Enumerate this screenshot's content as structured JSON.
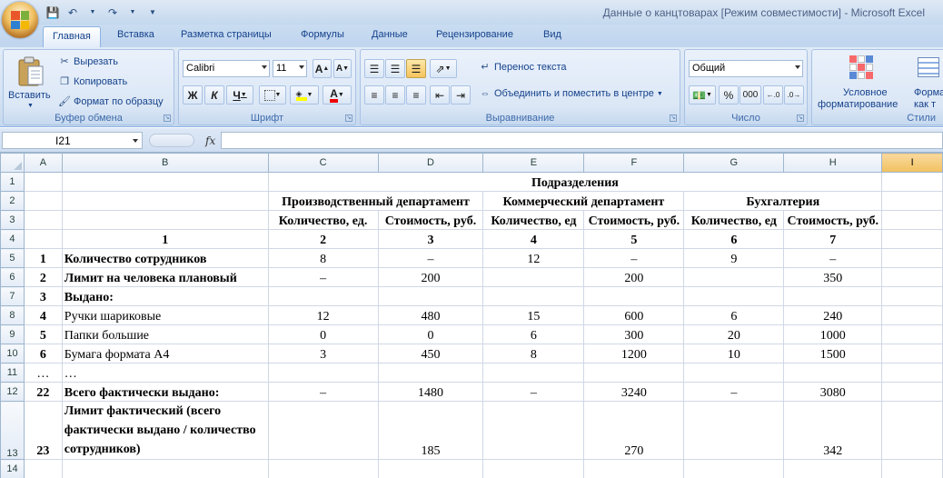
{
  "window": {
    "title": "Данные о канцтоварах  [Режим совместимости] - Microsoft Excel"
  },
  "tabs": [
    "Главная",
    "Вставка",
    "Разметка страницы",
    "Формулы",
    "Данные",
    "Рецензирование",
    "Вид"
  ],
  "ribbon": {
    "clipboard": {
      "label": "Буфер обмена",
      "paste": "Вставить",
      "cut": "Вырезать",
      "copy": "Копировать",
      "format_painter": "Формат по образцу"
    },
    "font": {
      "label": "Шрифт",
      "name": "Calibri",
      "size": "11",
      "bold": "Ж",
      "italic": "К",
      "underline": "Ч",
      "grow": "A",
      "shrink": "A",
      "color_letter": "A"
    },
    "alignment": {
      "label": "Выравнивание",
      "wrap": "Перенос текста",
      "merge": "Объединить и поместить в центре"
    },
    "number": {
      "label": "Число",
      "format": "Общий",
      "percent": "%",
      "thousands": "000"
    },
    "styles": {
      "label": "Стили",
      "conditional_line1": "Условное",
      "conditional_line2": "форматирование",
      "format_as_line1": "Форма",
      "format_as_line2": "как т"
    }
  },
  "formula_bar": {
    "name_box": "I21",
    "fx": "fx",
    "formula": ""
  },
  "colors": {
    "selected_header": "#f1c15f",
    "grid_line": "#d0d7e5",
    "header_bg": "#e4ecf7"
  },
  "columns": [
    "A",
    "B",
    "C",
    "D",
    "E",
    "F",
    "G",
    "H",
    "I"
  ],
  "rows": [
    "1",
    "2",
    "3",
    "4",
    "5",
    "6",
    "7",
    "8",
    "9",
    "10",
    "11",
    "12",
    "13",
    "14"
  ],
  "cells": {
    "r1": {
      "c": "Подразделения"
    },
    "r2": {
      "c": "Производственный департамент",
      "e": "Коммерческий департамент",
      "g": "Бухгалтерия"
    },
    "r3": {
      "c": "Количество, ед.",
      "d": "Стоимость, руб.",
      "e": "Количество, ед",
      "f": "Стоимость, руб.",
      "g": "Количество, ед",
      "h": "Стоимость, руб."
    },
    "r4": {
      "b": "1",
      "c": "2",
      "d": "3",
      "e": "4",
      "f": "5",
      "g": "6",
      "h": "7"
    },
    "r5": {
      "a": "1",
      "b": "Количество сотрудников",
      "c": "8",
      "d": "–",
      "e": "12",
      "f": "–",
      "g": "9",
      "h": "–"
    },
    "r6": {
      "a": "2",
      "b": "Лимит на человека плановый",
      "c": "–",
      "d": "200",
      "f": "200",
      "h": "350"
    },
    "r7": {
      "a": "3",
      "b": "Выдано:"
    },
    "r8": {
      "a": "4",
      "b": "Ручки шариковые",
      "c": "12",
      "d": "480",
      "e": "15",
      "f": "600",
      "g": "6",
      "h": "240"
    },
    "r9": {
      "a": "5",
      "b": "Папки большие",
      "c": "0",
      "d": "0",
      "e": "6",
      "f": "300",
      "g": "20",
      "h": "1000"
    },
    "r10": {
      "a": "6",
      "b": "Бумага формата А4",
      "c": "3",
      "d": "450",
      "e": "8",
      "f": "1200",
      "g": "10",
      "h": "1500"
    },
    "r11": {
      "a": "…",
      "b": "…"
    },
    "r12": {
      "a": "22",
      "b": "Всего фактически выдано:",
      "c": "–",
      "d": "1480",
      "e": "–",
      "f": "3240",
      "g": "–",
      "h": "3080"
    },
    "r13": {
      "a": "23",
      "b": "Лимит фактический  (всего фактически выдано / количество сотрудников)",
      "d": "185",
      "f": "270",
      "h": "342"
    }
  }
}
